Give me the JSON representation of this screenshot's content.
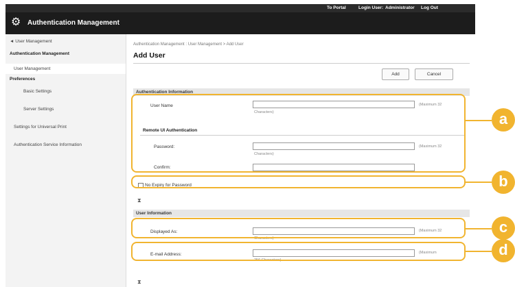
{
  "topbar": {
    "portal": "To Portal",
    "login_user_label": "Login User:",
    "login_user": "Administrator",
    "logout": "Log Out"
  },
  "app": {
    "title": "Authentication Management"
  },
  "sidebar": {
    "items": [
      {
        "label": "◄ User Management"
      },
      {
        "label": "Authentication Management"
      },
      {
        "label": "User Management"
      },
      {
        "label": "Preferences"
      },
      {
        "label": "Basic Settings"
      },
      {
        "label": "Server Settings"
      },
      {
        "label": "Settings for Universal Print"
      },
      {
        "label": "Authentication Service Information"
      }
    ]
  },
  "main": {
    "breadcrumb": "Authentication Management : User Management > Add User",
    "title": "Add User",
    "add_label": "Add",
    "cancel_label": "Cancel",
    "auth_section": "Authentication Information",
    "user_name_label": "User Name",
    "max32_hint_a": "(Maximum 32",
    "max32_hint_b": "Characters)",
    "remote_heading": "Remote UI Authentication",
    "password_label": "Password:",
    "confirm_label": "Confirm:",
    "no_expiry_label": "No Expiry for Password",
    "user_info_section": "User Information",
    "displayed_as_label": "Displayed As:",
    "email_label": "E-mail Address:",
    "max256_hint_a": "(Maximum",
    "max256_hint_b": "256 Characters)",
    "toggle_glyph": "⧗"
  },
  "callouts": {
    "a": "a",
    "b": "b",
    "c": "c",
    "d": "d"
  },
  "colors": {
    "accent": "#f1b42f",
    "titlebar": "#1c1c1c"
  }
}
